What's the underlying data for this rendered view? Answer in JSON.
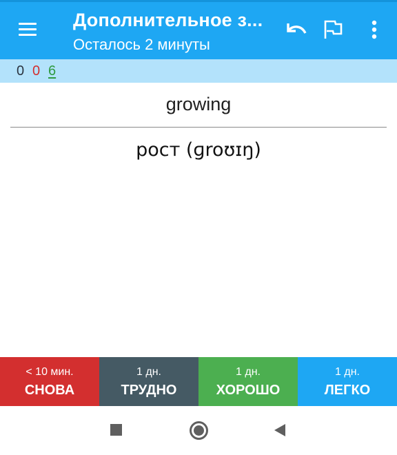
{
  "app_bar": {
    "title": "Дополнительное з...",
    "subtitle": "Осталось 2 минуты",
    "background": "#1ea7f3"
  },
  "icons": {
    "menu": "hamburger-menu-icon",
    "undo": "undo-arrow-icon",
    "flag": "flag-outline-icon",
    "more": "more-vertical-icon"
  },
  "counts": {
    "new": "0",
    "learning": "0",
    "review": "6",
    "colors": {
      "new": "#2b3440",
      "learning": "#d32f2f",
      "review": "#2e9a3e"
    }
  },
  "card": {
    "question": "growing",
    "answer": "рост (ɡroʊɪŋ)"
  },
  "answer_buttons": [
    {
      "interval": "< 10 мин.",
      "label": "СНОВА",
      "color": "#d32f2f"
    },
    {
      "interval": "1 дн.",
      "label": "ТРУДНО",
      "color": "#455a64"
    },
    {
      "interval": "1 дн.",
      "label": "ХОРОШО",
      "color": "#4caf50"
    },
    {
      "interval": "1 дн.",
      "label": "ЛЕГКО",
      "color": "#1ea7f3"
    }
  ],
  "system_nav": {
    "recents": "recents-square-icon",
    "home": "home-circle-icon",
    "back": "back-triangle-icon"
  }
}
